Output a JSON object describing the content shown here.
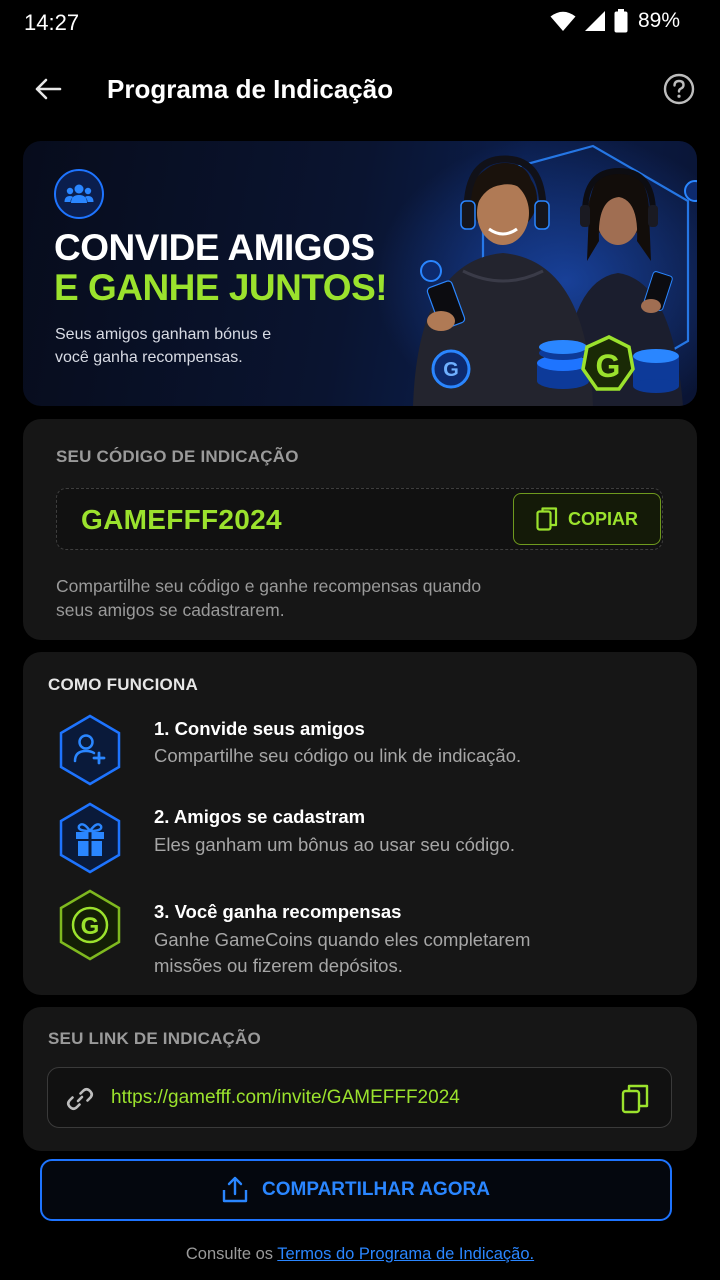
{
  "status_bar": {
    "time": "14:27",
    "battery": "89%"
  },
  "app_bar": {
    "title": "Programa de Indicação",
    "back_icon": "arrow-left-icon",
    "help_icon": "help-circle-icon"
  },
  "hero": {
    "line1": "CONVIDE AMIGOS",
    "line2": "E GANHE JUNTOS!",
    "subtitle": "Seus amigos ganham bónus e você ganha recompensas.",
    "accent_color": "#9be22d",
    "brand_blue": "#1e74ff"
  },
  "referral_code": {
    "label": "SEU CÓDIGO DE INDICAÇÃO",
    "code": "GAMEFFF2024",
    "copy_label": "COPIAR",
    "help_text": "Compartilhe seu código e ganhe recompensas quando seus amigos se cadastrarem."
  },
  "how_it_works": {
    "title": "COMO FUNCIONA",
    "steps": [
      {
        "title": "1. Convide seus amigos",
        "desc": "Compartilhe seu código ou link de indicação.",
        "icon": "add-user-icon"
      },
      {
        "title": "2. Amigos se cadastram",
        "desc": "Eles ganham um bônus ao usar seu código.",
        "icon": "gift-icon"
      },
      {
        "title": "3. Você ganha recompensas",
        "desc": "Ganhe GameCoins quando eles completarem missões ou fizerem depósitos.",
        "icon": "gamecoin-icon"
      }
    ]
  },
  "referral_link": {
    "label": "SEU LINK DE INDICAÇÃO",
    "url": "https://gamefff.com/invite/GAMEFFF2024"
  },
  "share_button": {
    "label": "COMPARTILHAR AGORA"
  },
  "footer": {
    "prefix": "Consulte os ",
    "link": "Termos do Programa de Indicação."
  }
}
